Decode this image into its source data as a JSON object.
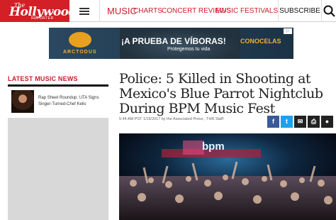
{
  "header": {
    "logo": {
      "the": "The",
      "name": "Hollywood",
      "reporter": "REPORTER"
    },
    "nav": [
      {
        "label": "MUSIC"
      },
      {
        "label": "CHARTS"
      },
      {
        "label": "CONCERT REVIEWS"
      },
      {
        "label": "MUSIC FESTIVALS"
      }
    ],
    "subscribe_label": "SUBSCRIBE",
    "colors": {
      "brand_red": "#d31f26",
      "nav_red": "#c81e2b"
    },
    "icons": [
      "menu-icon",
      "search-icon"
    ]
  },
  "ad": {
    "brand": "ARCTODUS",
    "headline": "¡A PRUEBA DE VÍBORAS!",
    "subline": "Protegemos tu vida",
    "right_text": "CONOCELAS",
    "choices_label": "▷"
  },
  "sidebar": {
    "title": "LATEST MUSIC NEWS",
    "items": [
      {
        "text": "Rap Sheet Roundup: UTA Signs Singer-Turned-Chef Kelis"
      }
    ]
  },
  "article": {
    "headline": "Police: 5 Killed in Shooting at Mexico's Blue Parrot Nightclub During BPM Music Fest",
    "byline": "5:44 AM PST 1/16/2017 by the Associated Press , THR Staff",
    "share": [
      {
        "label": "f",
        "icon": "facebook-icon"
      },
      {
        "label": "t",
        "icon": "twitter-icon"
      },
      {
        "label": "✉",
        "icon": "mail-icon"
      },
      {
        "label": "⎙",
        "icon": "print-icon"
      },
      {
        "label": "●",
        "icon": "comment-icon"
      }
    ],
    "photo_sign": "bpm"
  }
}
